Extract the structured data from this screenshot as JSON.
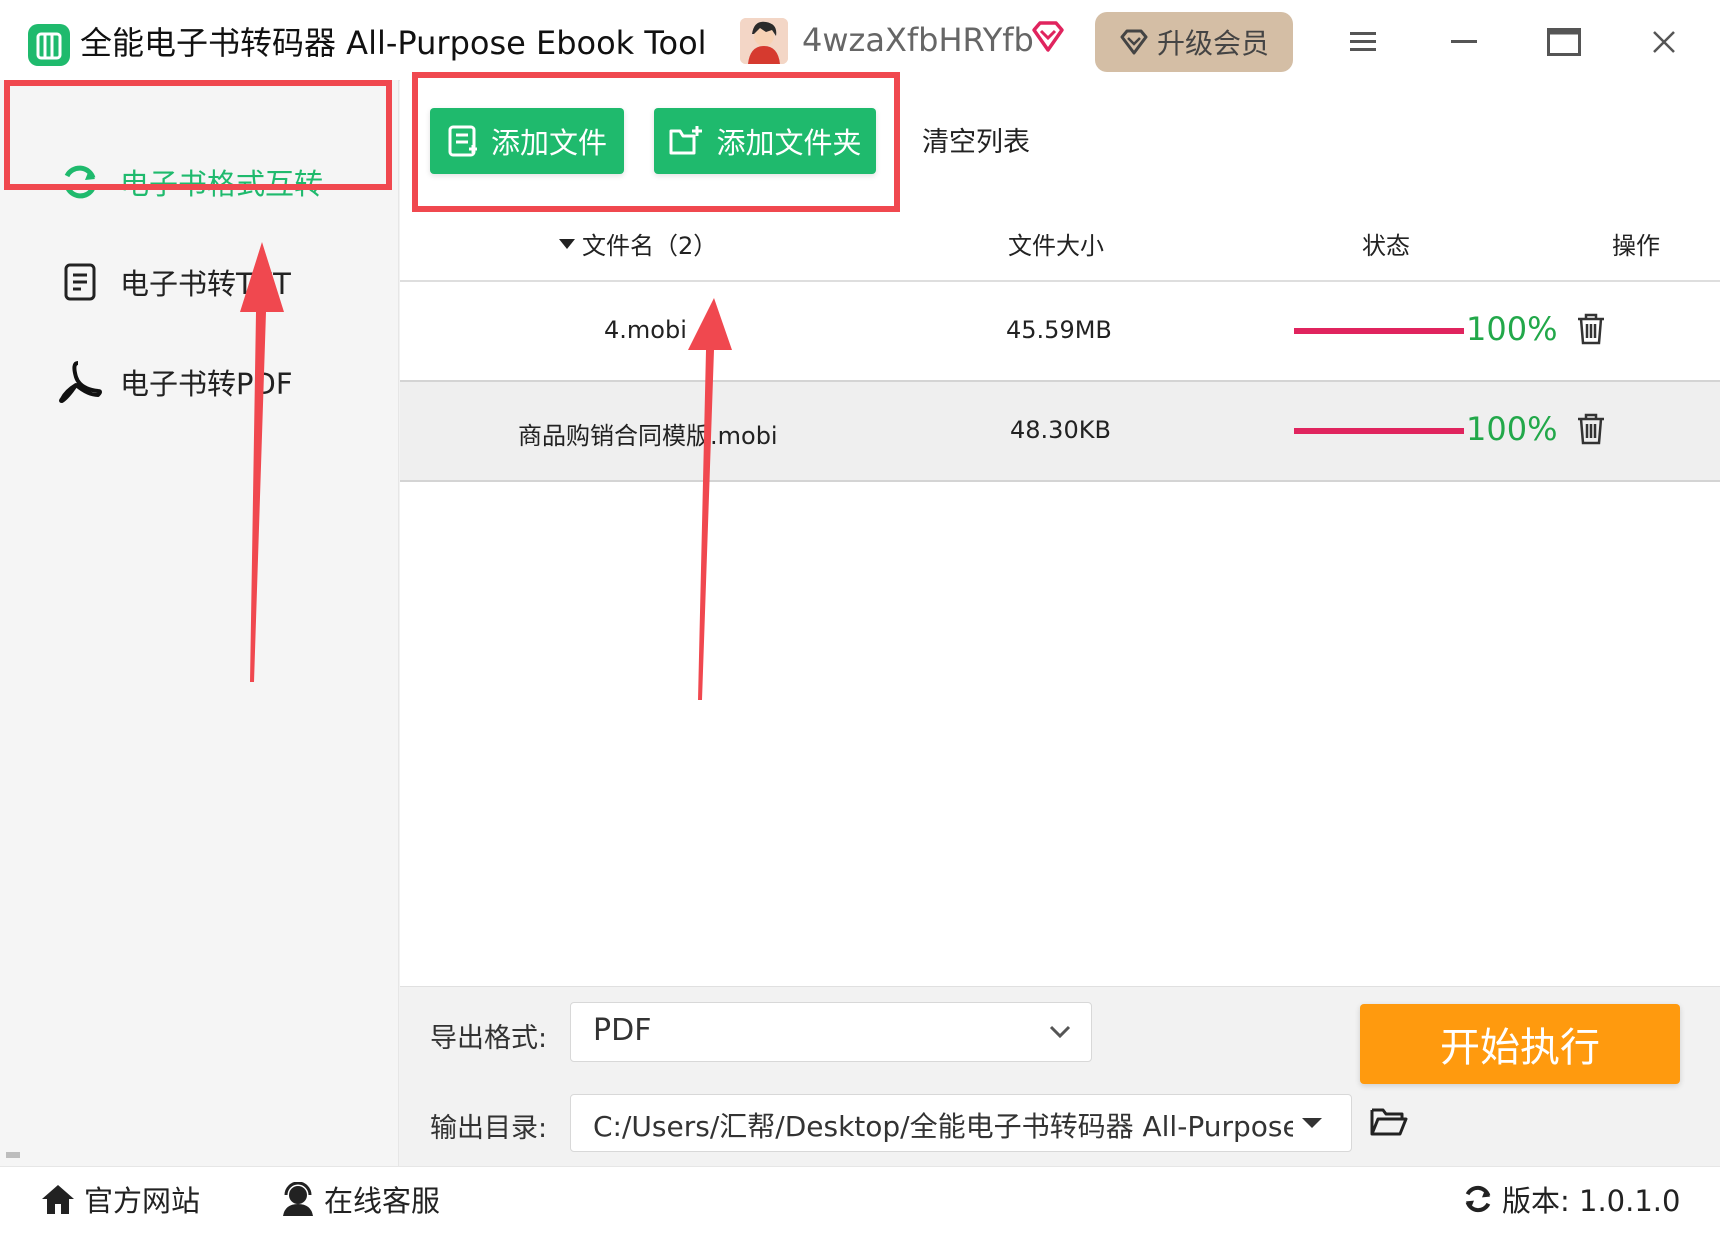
{
  "titlebar": {
    "app_title": "全能电子书转码器 All-Purpose Ebook Tool",
    "username": "4wzaXfbHRYfb",
    "upgrade_label": "升级会员"
  },
  "sidebar": {
    "items": [
      {
        "label": "电子书格式互转",
        "icon": "refresh-icon",
        "active": true
      },
      {
        "label": "电子书转TXT",
        "icon": "document-icon",
        "active": false
      },
      {
        "label": "电子书转PDF",
        "icon": "pdf-icon",
        "active": false
      }
    ]
  },
  "toolbar": {
    "add_file": "添加文件",
    "add_folder": "添加文件夹",
    "clear_list": "清空列表"
  },
  "table": {
    "headers": {
      "name": "文件名（2）",
      "size": "文件大小",
      "status": "状态",
      "action": "操作"
    },
    "rows": [
      {
        "name": "4.mobi",
        "size": "45.59MB",
        "progress": 1.0,
        "progress_text": "100%"
      },
      {
        "name": "商品购销合同模版.mobi",
        "size": "48.30KB",
        "progress": 1.0,
        "progress_text": "100%"
      }
    ]
  },
  "bottom": {
    "format_label": "导出格式:",
    "format_value": "PDF",
    "output_label": "输出目录:",
    "output_value": "C:/Users/汇帮/Desktop/全能电子书转码器 All-Purpose Ebook Tool",
    "start_label": "开始执行"
  },
  "footer": {
    "website": "官方网站",
    "support": "在线客服",
    "version": "版本: 1.0.1.0"
  },
  "colors": {
    "accent_green": "#1fba6d",
    "start_orange": "#ff9a0e",
    "progress_pink": "#e0245e",
    "percent_green": "#22a84a",
    "annotation_red": "#f0484f",
    "upgrade_tan": "#d4bea5"
  }
}
